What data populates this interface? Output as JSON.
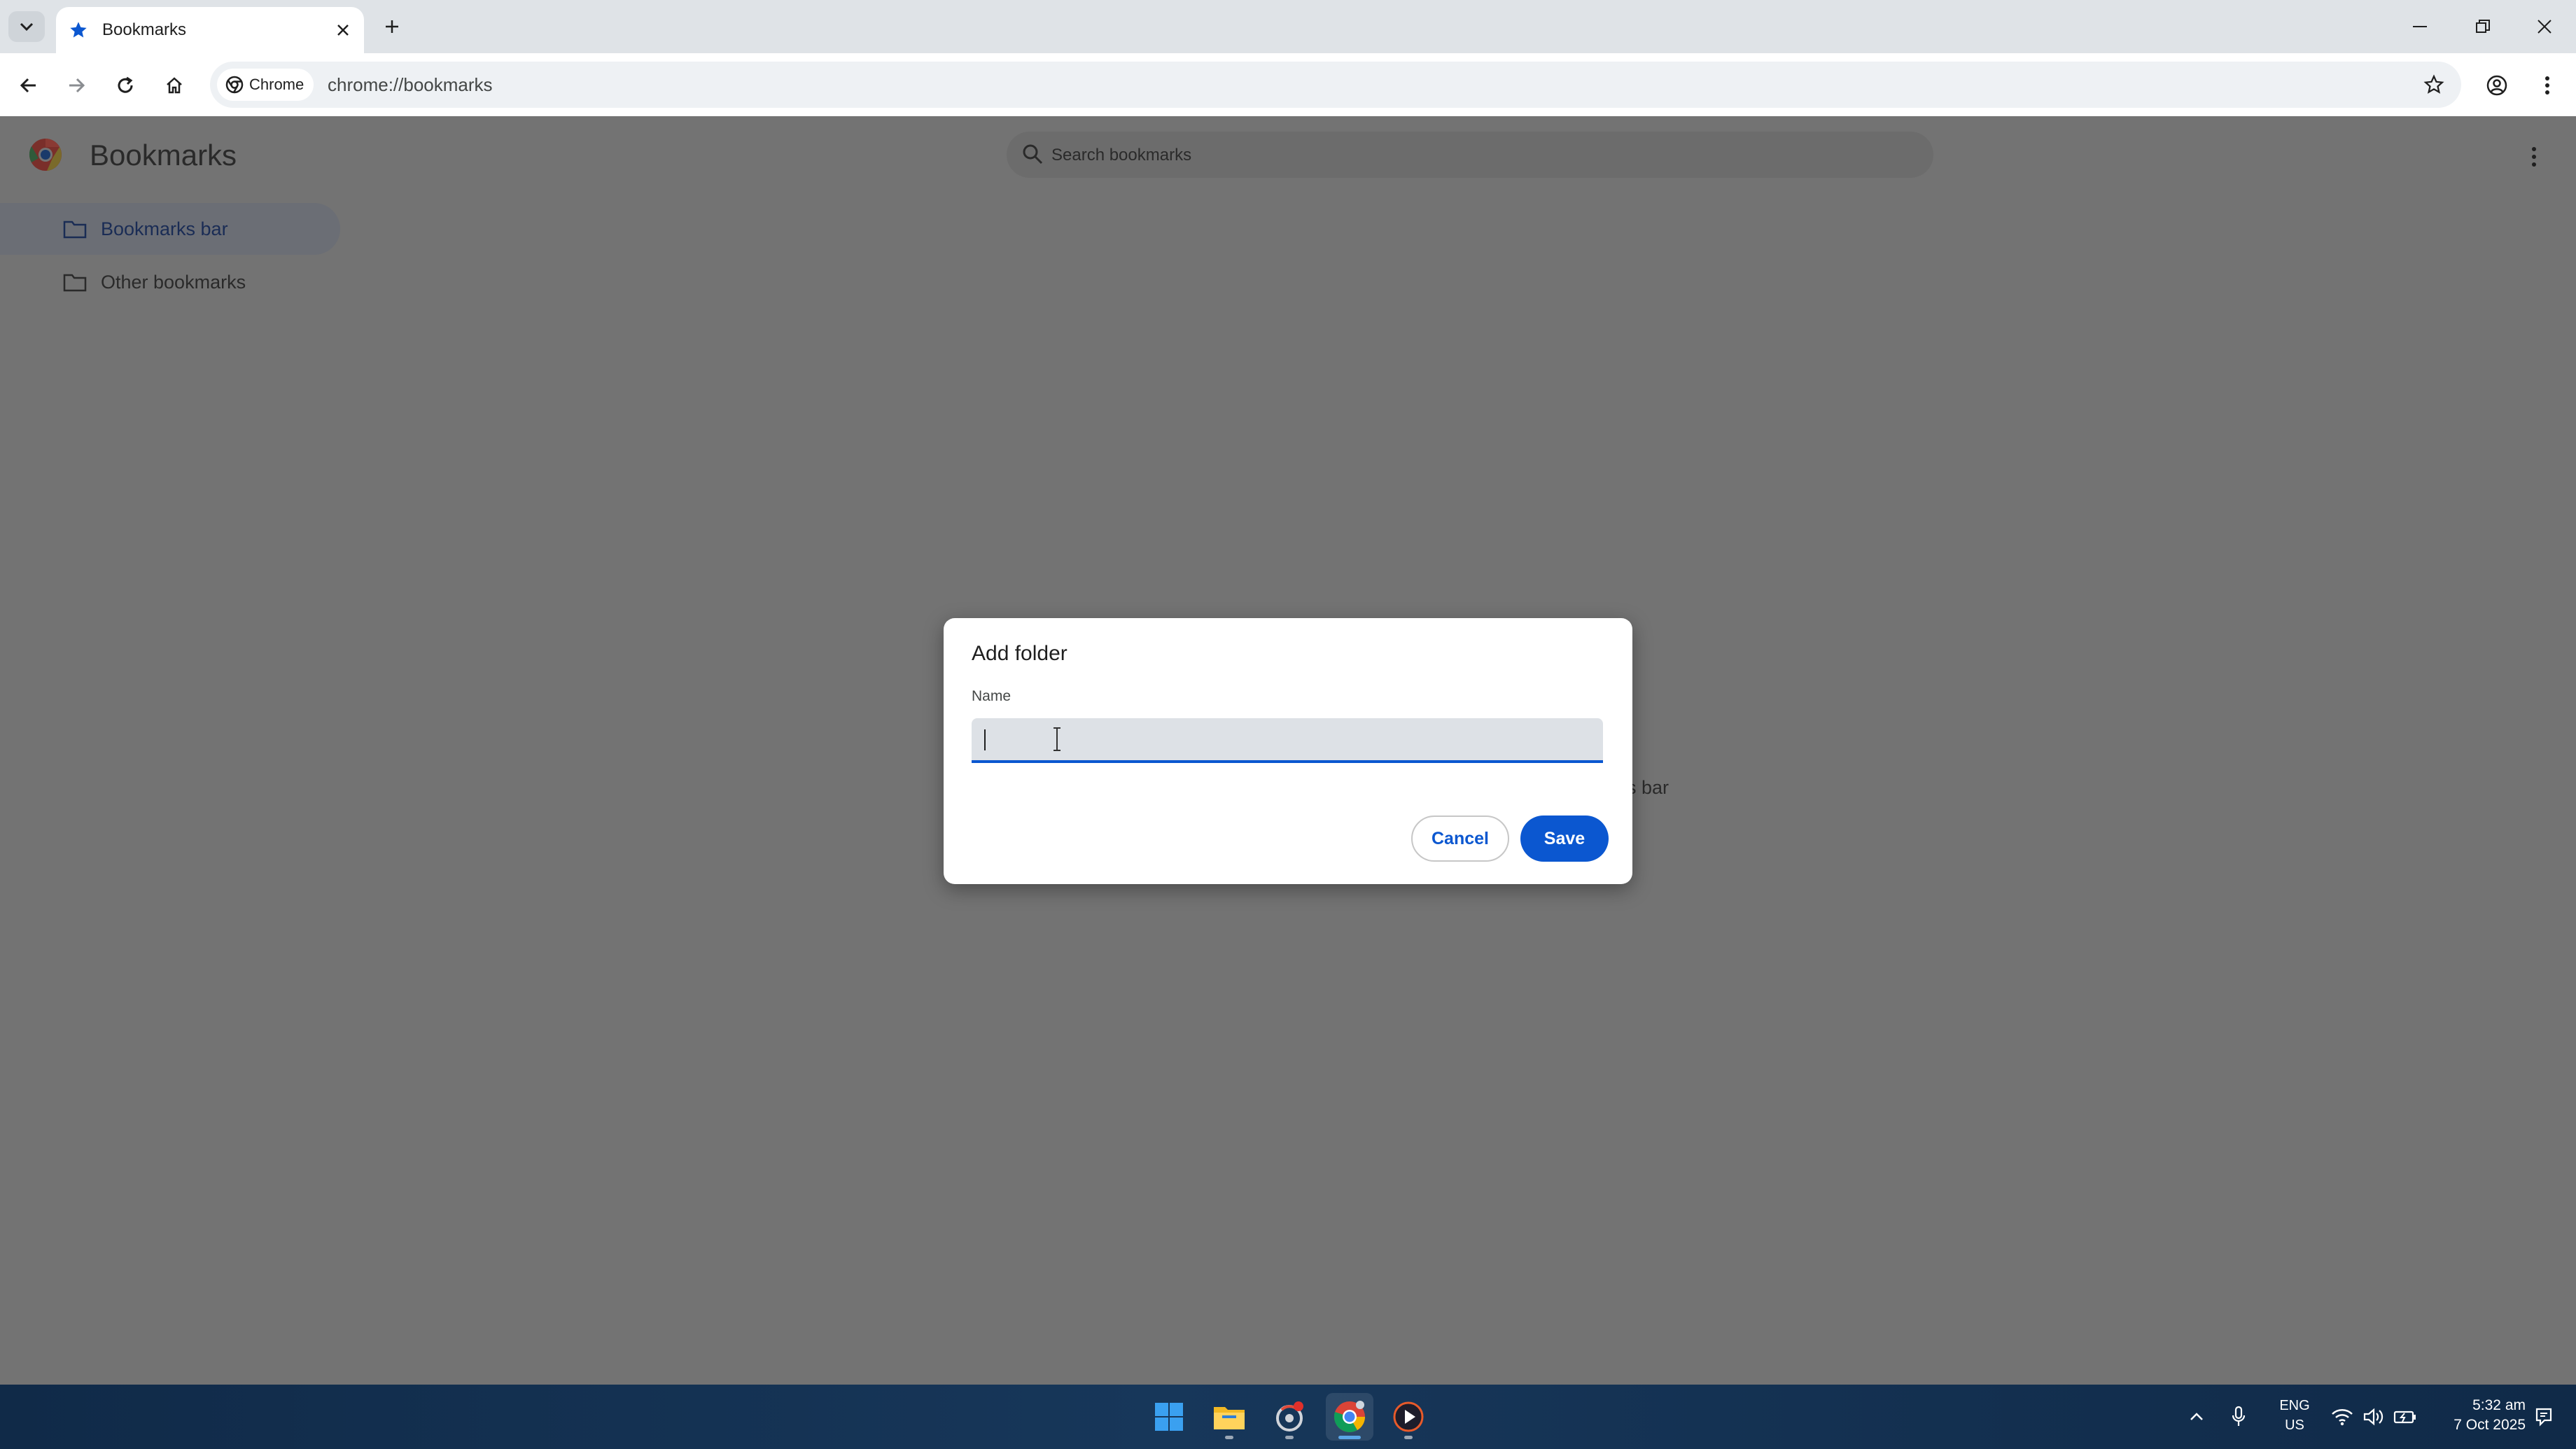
{
  "browser": {
    "tab": {
      "title": "Bookmarks"
    },
    "address": {
      "chip_label": "Chrome",
      "url": "chrome://bookmarks"
    }
  },
  "page": {
    "title": "Bookmarks",
    "search_placeholder": "Search bookmarks",
    "sidebar": {
      "items": [
        {
          "label": "Bookmarks bar",
          "selected": true
        },
        {
          "label": "Other bookmarks",
          "selected": false
        }
      ]
    },
    "empty_hint_fragment": "s bar"
  },
  "dialog": {
    "title": "Add folder",
    "field_label": "Name",
    "name_value": "",
    "cancel_label": "Cancel",
    "save_label": "Save"
  },
  "taskbar": {
    "apps": [
      "start-icon",
      "file-explorer-icon",
      "settings-app-icon",
      "chrome-icon",
      "media-player-icon"
    ],
    "language": {
      "line1": "ENG",
      "line2": "US"
    },
    "clock": {
      "time": "5:32 am",
      "date": "7 Oct 2025"
    }
  },
  "colors": {
    "accent": "#0b57d0",
    "overlay_page": "#737373",
    "taskbar": "#102a48"
  }
}
